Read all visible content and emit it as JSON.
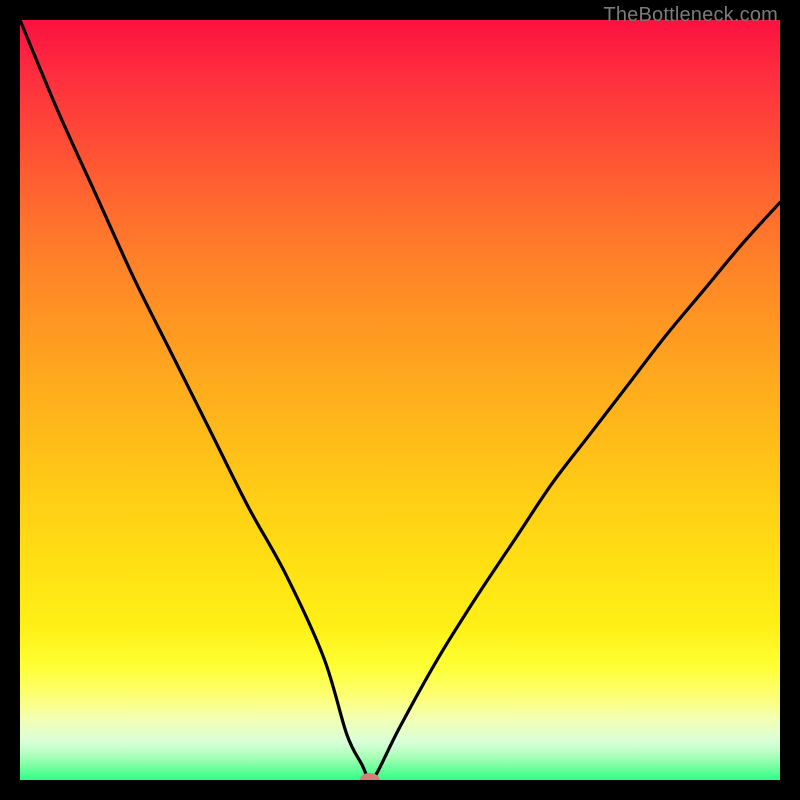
{
  "watermark": "TheBottleneck.com",
  "chart_data": {
    "type": "line",
    "title": "",
    "xlabel": "",
    "ylabel": "",
    "xlim": [
      0,
      100
    ],
    "ylim": [
      0,
      100
    ],
    "grid": false,
    "series": [
      {
        "name": "bottleneck-curve",
        "x": [
          0,
          5,
          10,
          15,
          20,
          25,
          30,
          35,
          40,
          43,
          45,
          46,
          47,
          50,
          55,
          60,
          65,
          70,
          75,
          80,
          85,
          90,
          95,
          100
        ],
        "values": [
          100,
          88,
          77,
          66,
          56,
          46,
          36,
          27,
          16,
          6,
          2,
          0,
          1,
          7,
          16,
          24,
          31.5,
          39,
          45.5,
          52,
          58.5,
          64.5,
          70.5,
          76
        ]
      }
    ],
    "markers": [
      {
        "name": "minimum-marker",
        "x": 46,
        "y": 0,
        "color": "#d48079"
      }
    ],
    "background": {
      "type": "vertical-gradient",
      "stops": [
        {
          "pos": 0.0,
          "color": "#fc113f"
        },
        {
          "pos": 0.5,
          "color": "#ffb81a"
        },
        {
          "pos": 0.85,
          "color": "#ffff34"
        },
        {
          "pos": 1.0,
          "color": "#2fff88"
        }
      ]
    }
  }
}
